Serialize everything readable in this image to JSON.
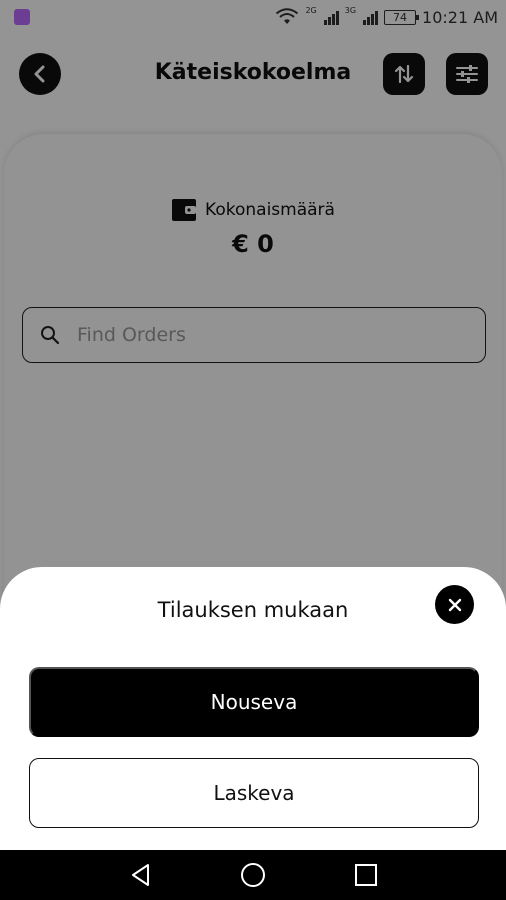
{
  "status_bar": {
    "network_2g": "2G",
    "network_3g": "3G",
    "battery_level": "74",
    "time": "10:21 AM"
  },
  "header": {
    "title": "Käteiskokoelma",
    "back_icon": "chevron-left-icon",
    "sort_icon": "sort-arrows-icon",
    "filter_icon": "sliders-icon"
  },
  "summary": {
    "label": "Kokonaismäärä",
    "value": "€ 0",
    "icon": "wallet-icon"
  },
  "search": {
    "placeholder": "Find Orders",
    "value": ""
  },
  "sort_sheet": {
    "title": "Tilauksen mukaan",
    "options": [
      {
        "label": "Nouseva",
        "selected": true
      },
      {
        "label": "Laskeva",
        "selected": false
      }
    ]
  },
  "colors": {
    "primary": "#000000",
    "background": "#ffffff",
    "scrim": "rgba(0,0,0,0.42)"
  }
}
